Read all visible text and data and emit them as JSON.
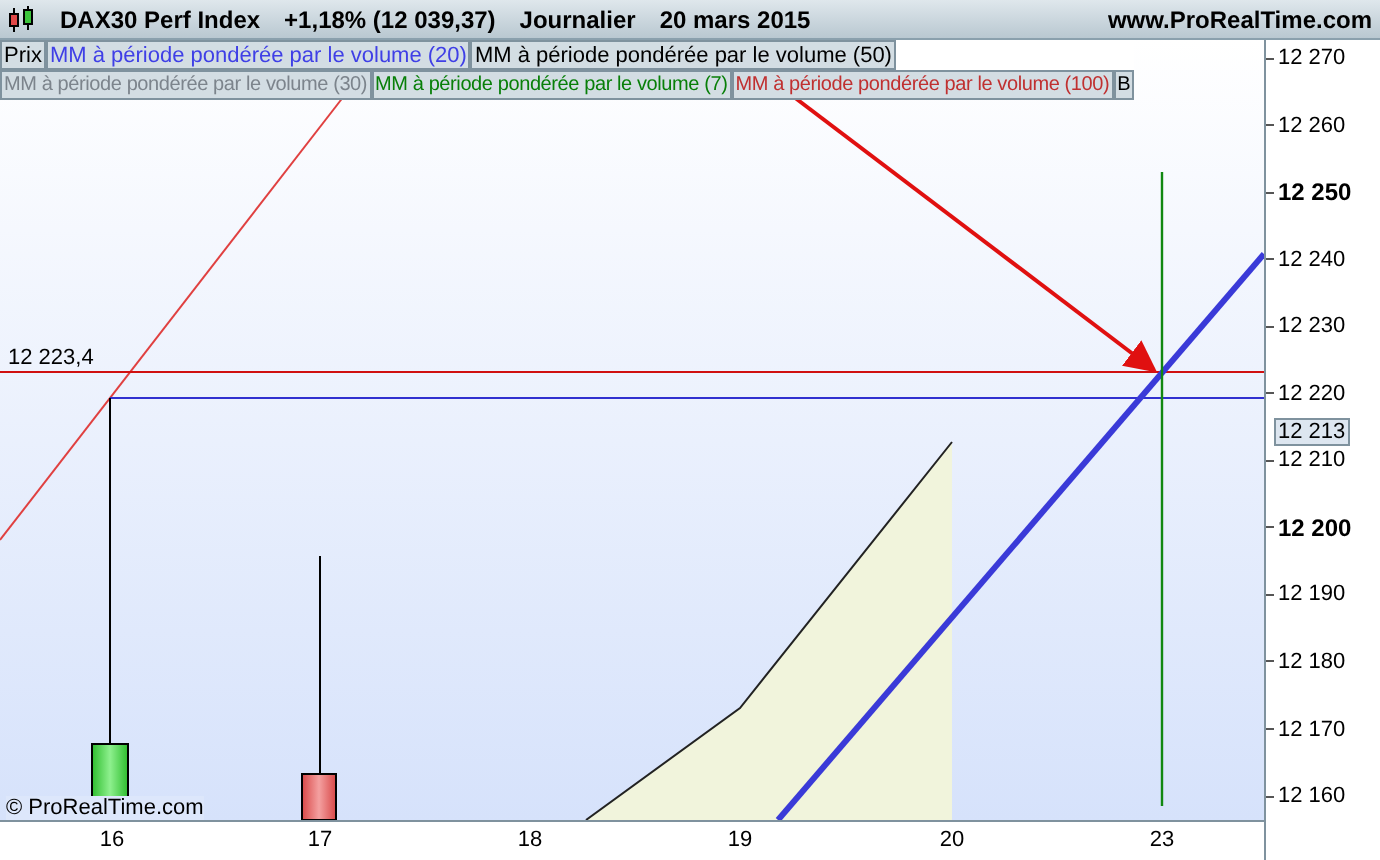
{
  "header": {
    "title": "DAX30 Perf Index",
    "change": "+1,18% (12 039,37)",
    "period": "Journalier",
    "date": "20 mars 2015",
    "site": "www.ProRealTime.com"
  },
  "legend_rows": [
    [
      {
        "label": "Prix",
        "color": "#000000"
      },
      {
        "label": "MM à période pondérée par le volume (20)",
        "color": "#3f3fe6"
      },
      {
        "label": "MM à période pondérée par le volume (50)",
        "color": "#000000"
      }
    ],
    [
      {
        "label": "MM à période pondérée par le volume (30)",
        "color": "#7c848c"
      },
      {
        "label": "MM à période pondérée par le volume (7)",
        "color": "#087f08"
      },
      {
        "label": "MM à période pondérée par le volume (100)",
        "color": "#c03030"
      },
      {
        "label": "B",
        "color": "#000000"
      }
    ]
  ],
  "level_label": "12 223,4",
  "copyright": "© ProRealTime.com",
  "y_ticks": [
    {
      "label": "12 270",
      "major": false
    },
    {
      "label": "12 260",
      "major": false
    },
    {
      "label": "12 250",
      "major": true
    },
    {
      "label": "12 240",
      "major": false
    },
    {
      "label": "12 230",
      "major": false
    },
    {
      "label": "12 220",
      "major": false
    },
    {
      "label": "12 210",
      "major": false
    },
    {
      "label": "12 200",
      "major": true
    },
    {
      "label": "12 190",
      "major": false
    },
    {
      "label": "12 180",
      "major": false
    },
    {
      "label": "12 170",
      "major": false
    },
    {
      "label": "12 160",
      "major": false
    }
  ],
  "price_marker": "12 213",
  "x_ticks": [
    "16",
    "17",
    "18",
    "19",
    "20",
    "23"
  ]
}
